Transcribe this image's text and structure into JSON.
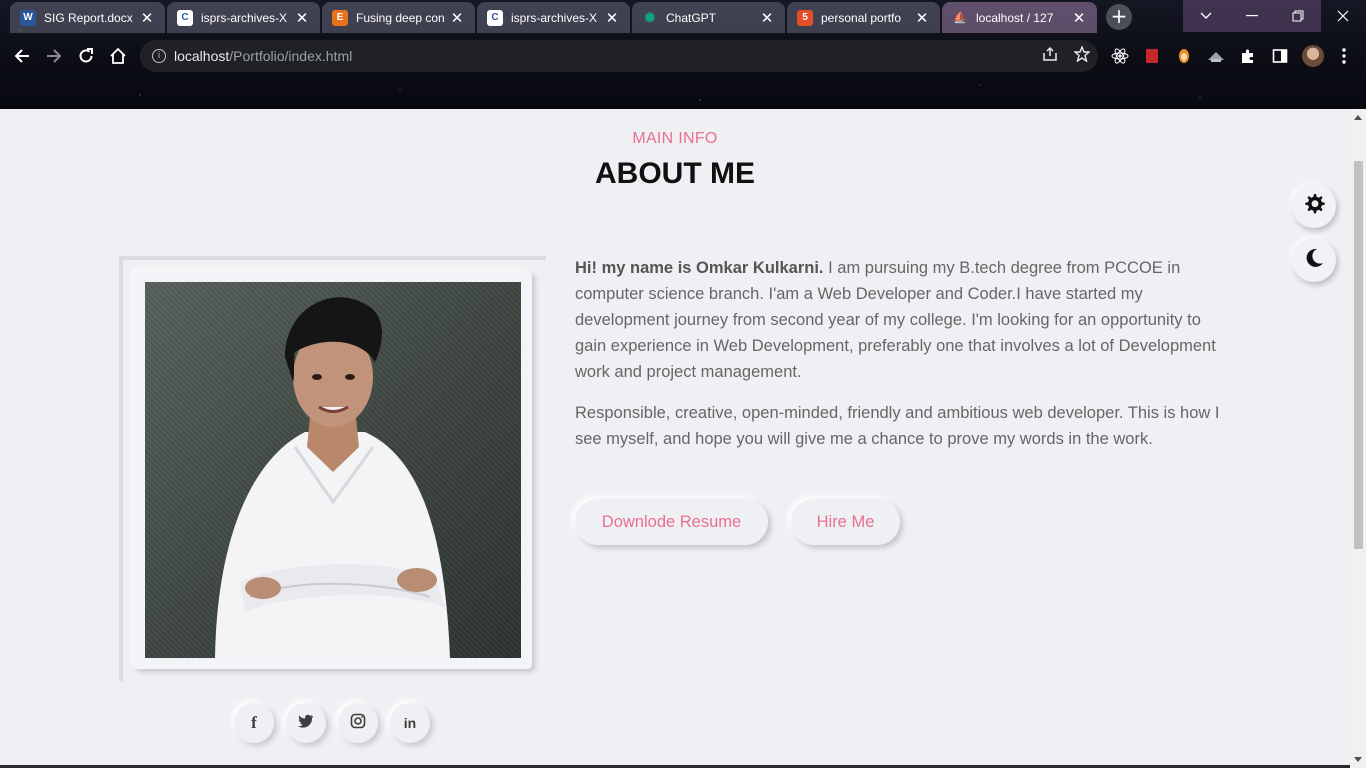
{
  "browser": {
    "tabs": [
      {
        "title": "SIG Report.docx",
        "icon": "word-icon",
        "color": "#2b579a",
        "glyph": "W"
      },
      {
        "title": "isprs-archives-X",
        "icon": "copernicus-icon",
        "color": "#2d5aa0",
        "glyph": "C"
      },
      {
        "title": "Fusing deep con",
        "icon": "elsevier-icon",
        "color": "#e9711c",
        "glyph": "E"
      },
      {
        "title": "isprs-archives-X",
        "icon": "copernicus-icon",
        "color": "#2d5aa0",
        "glyph": "C"
      },
      {
        "title": "ChatGPT",
        "icon": "chatgpt-icon",
        "color": "#10a37f",
        "glyph": "✺"
      },
      {
        "title": "personal portfo",
        "icon": "html5-icon",
        "color": "#e44d26",
        "glyph": "5"
      },
      {
        "title": "localhost / 127",
        "icon": "phpmyadmin-icon",
        "color": "#f29111",
        "glyph": "⛵"
      }
    ],
    "close_glyph": "✕",
    "new_tab_glyph": "+",
    "url_host": "localhost",
    "url_path": "/Portfolio/index.html"
  },
  "page": {
    "subtitle": "MAIN INFO",
    "title": "ABOUT ME",
    "intro_bold": "Hi! my name is Omkar Kulkarni.",
    "intro_rest": " I am pursuing my B.tech degree from PCCOE in computer science branch. I'am a Web Developer and Coder.I have started my development journey from second year of my college. I'm looking for an opportunity to gain experience in Web Development, preferably one that involves a lot of Development work and project management.",
    "paragraph2": "Responsible, creative, open-minded, friendly and ambitious web developer. This is how I see myself, and hope you will give me a chance to prove my words in the work.",
    "resume_button": "Downlode Resume",
    "hire_button": "Hire Me",
    "social": [
      {
        "name": "facebook-icon",
        "glyph": "f"
      },
      {
        "name": "twitter-icon",
        "glyph": ""
      },
      {
        "name": "instagram-icon",
        "glyph": ""
      },
      {
        "name": "linkedin-icon",
        "glyph": "in"
      }
    ],
    "accent_color": "#ea6f91"
  }
}
